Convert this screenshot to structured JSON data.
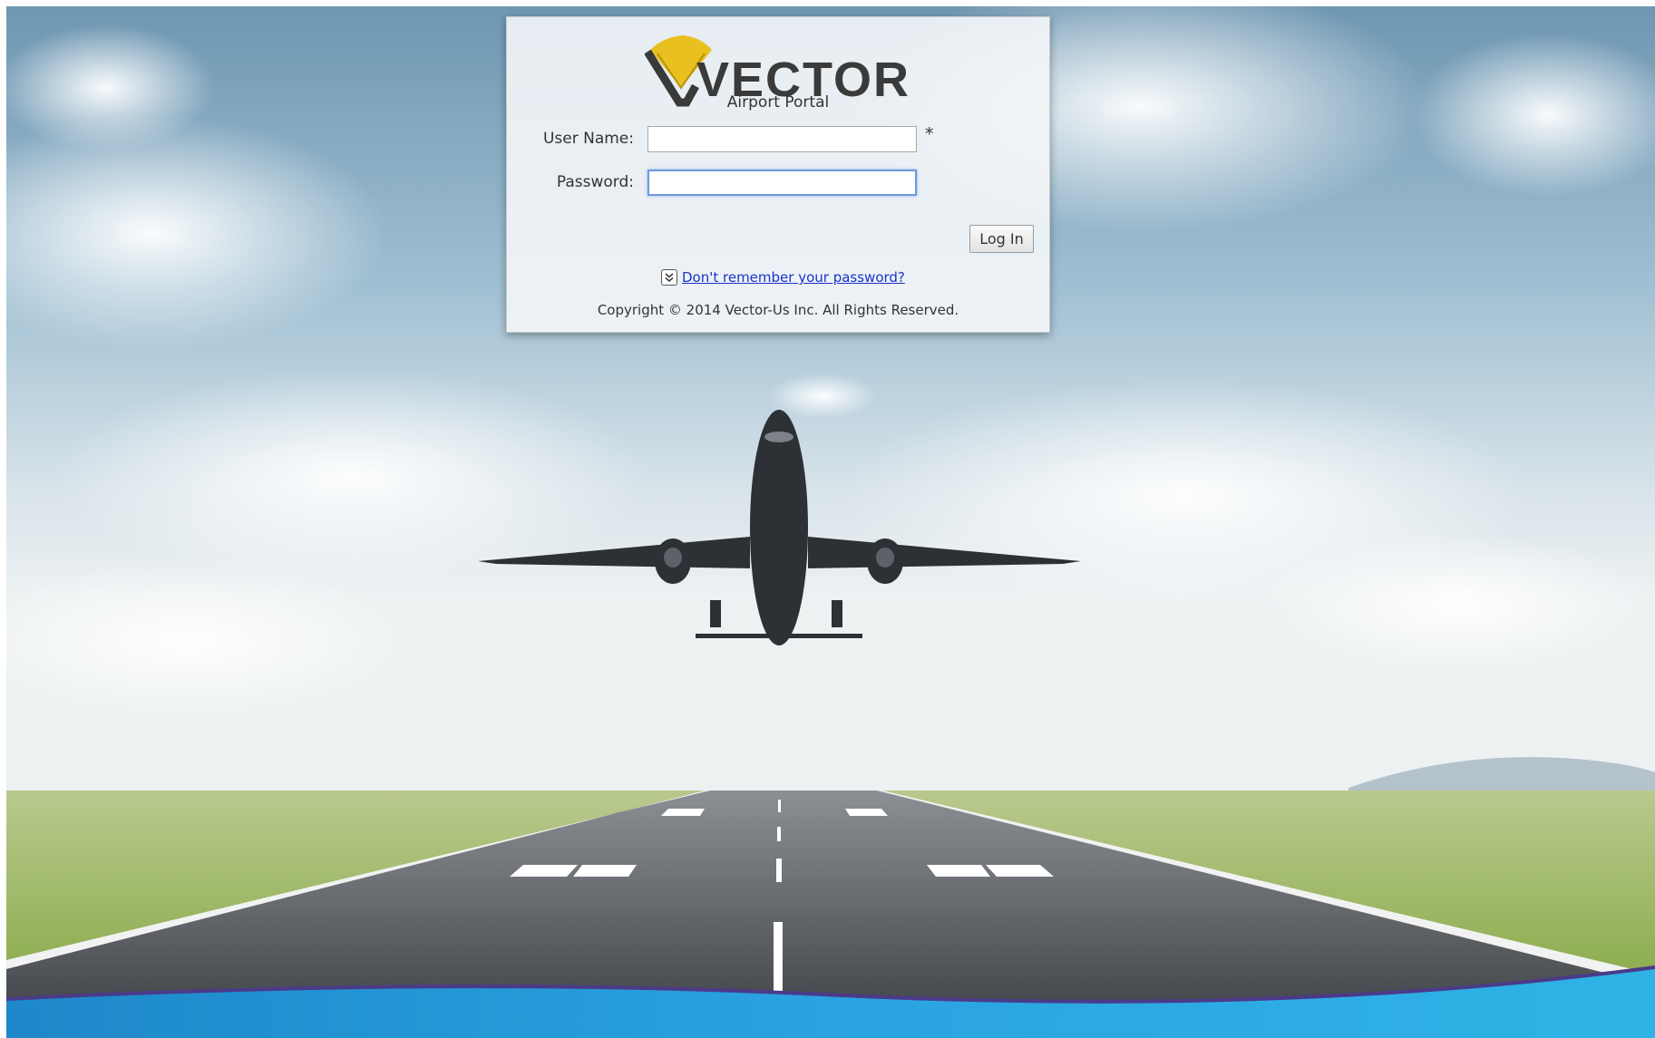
{
  "app": {
    "brand": "VECTOR",
    "subtitle": "Airport Portal"
  },
  "login": {
    "username_label": "User Name:",
    "username_value": "",
    "username_required_mark": "*",
    "password_label": "Password:",
    "password_value": "",
    "submit_label": "Log In",
    "forgot_password_link": "Don't remember your password?"
  },
  "footer": {
    "copyright": "Copyright © 2014 Vector-Us Inc. All Rights Reserved."
  },
  "icons": {
    "logo": "vector-logo-icon",
    "expand": "double-chevron-down-icon"
  },
  "colors": {
    "link": "#1a33cc",
    "logo_yellow": "#e8c020",
    "focus_border": "#6c9ae0",
    "bottom_wave": "#1f9ad8"
  }
}
